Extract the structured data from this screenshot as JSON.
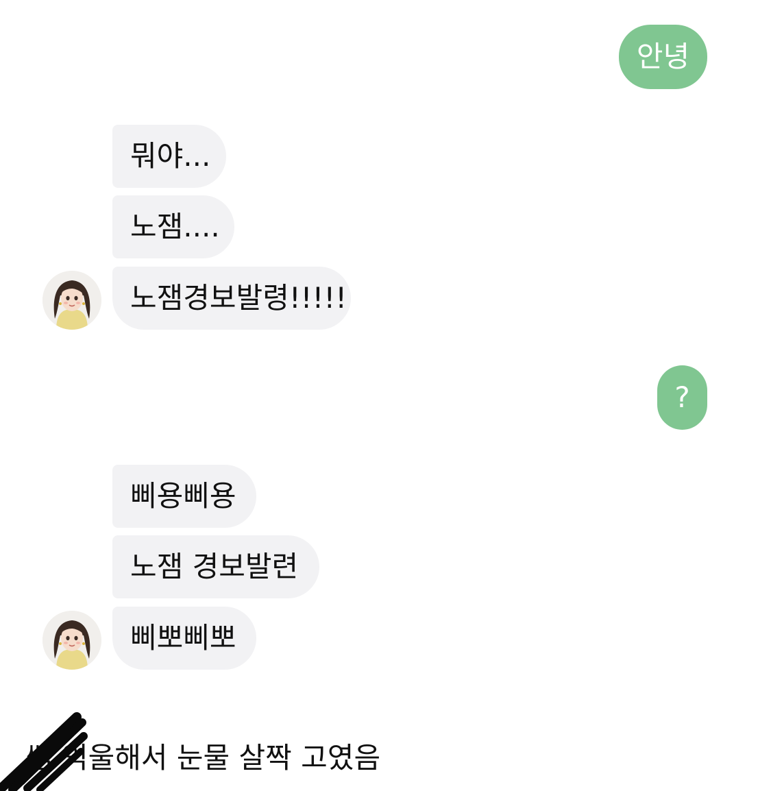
{
  "messages": {
    "sent_1": "안녕",
    "recv_1": "뭐야...",
    "recv_2": "노잼....",
    "recv_3": "노잼경보발령!!!!!",
    "sent_2": "?",
    "recv_4": "삐용삐용",
    "recv_5": "노잼 경보발련",
    "recv_6": "삐뽀삐뽀"
  },
  "caption": {
    "text": "쌤 억울해서 눈물 살짝 고였음"
  },
  "colors": {
    "sent_bubble": "#80c691",
    "received_bubble": "#f2f2f4"
  },
  "icons": {
    "avatar": "girl-portrait-avatar",
    "redaction": "black-pen-scribble"
  }
}
